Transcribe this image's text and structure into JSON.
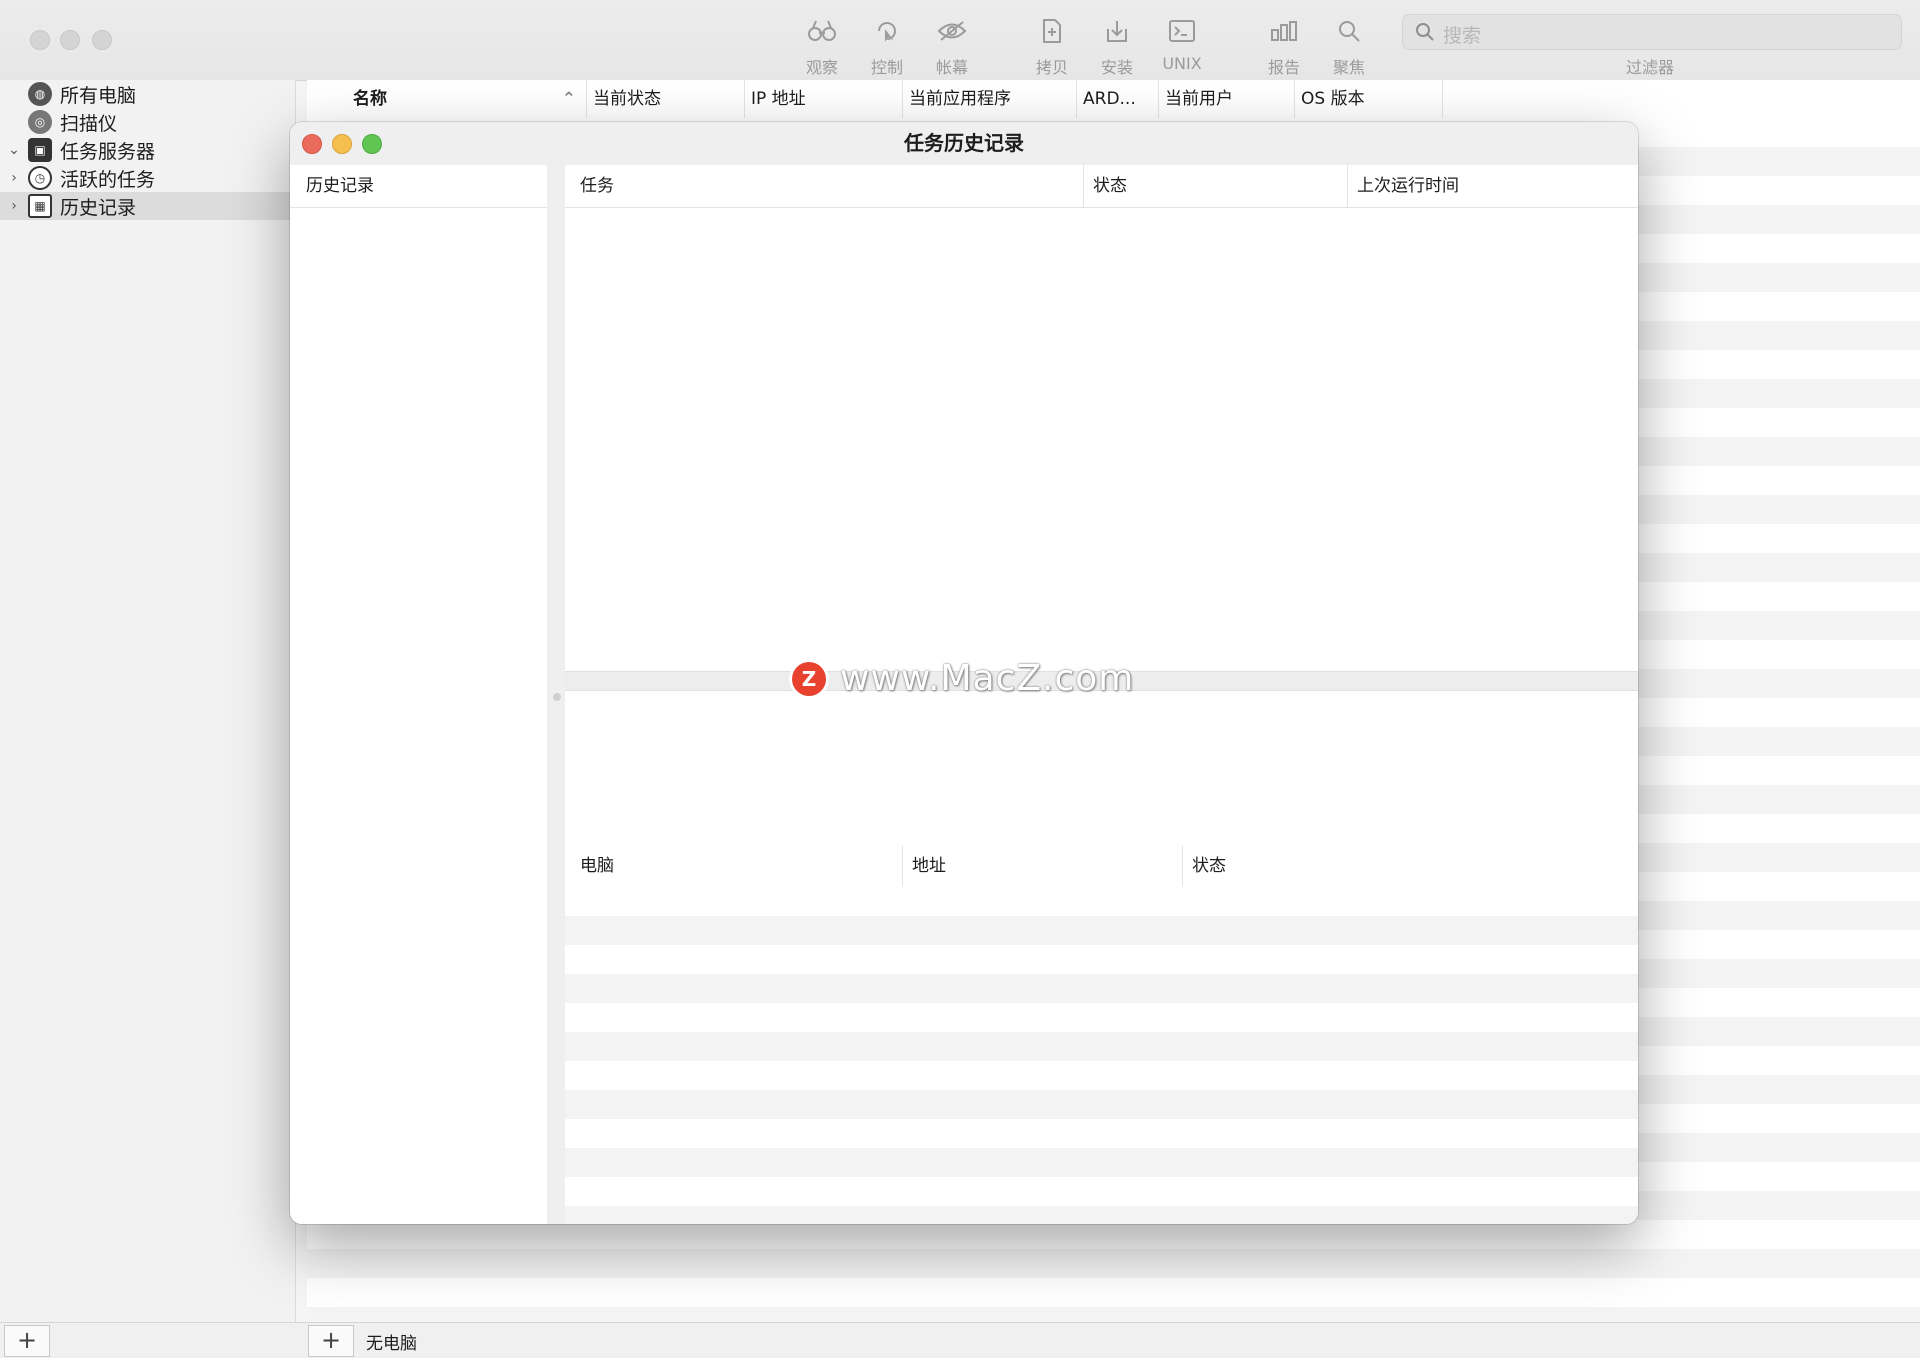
{
  "toolbar": {
    "items": [
      {
        "label": "观察",
        "icon": "binoculars-icon"
      },
      {
        "label": "控制",
        "icon": "cursor-control-icon"
      },
      {
        "label": "帐幕",
        "icon": "eye-slash-icon"
      },
      {
        "label": "拷贝",
        "icon": "doc-copy-icon"
      },
      {
        "label": "安装",
        "icon": "install-icon"
      },
      {
        "label": "UNIX",
        "icon": "terminal-icon"
      },
      {
        "label": "报告",
        "icon": "chart-bars-icon"
      },
      {
        "label": "聚焦",
        "icon": "search-icon"
      }
    ],
    "search_placeholder": "搜索",
    "filter_label": "过滤器"
  },
  "sidebar": {
    "items": [
      {
        "label": "所有电脑",
        "icon": "network-globe-icon"
      },
      {
        "label": "扫描仪",
        "icon": "radar-icon"
      },
      {
        "label": "任务服务器",
        "icon": "task-server-icon"
      },
      {
        "label": "活跃的任务",
        "icon": "clock-icon"
      },
      {
        "label": "历史记录",
        "icon": "calendar-icon"
      }
    ]
  },
  "list": {
    "columns": [
      "名称",
      "当前状态",
      "IP 地址",
      "当前应用程序",
      "ARD...",
      "当前用户",
      "OS 版本"
    ]
  },
  "status": {
    "text": "无电脑"
  },
  "dialog": {
    "title": "任务历史记录",
    "left_header": "历史记录",
    "task_columns": [
      "任务",
      "状态",
      "上次运行时间"
    ],
    "computer_columns": [
      "电脑",
      "地址",
      "状态"
    ]
  },
  "watermark": {
    "text": "www.MacZ.com",
    "logo": "Z"
  }
}
